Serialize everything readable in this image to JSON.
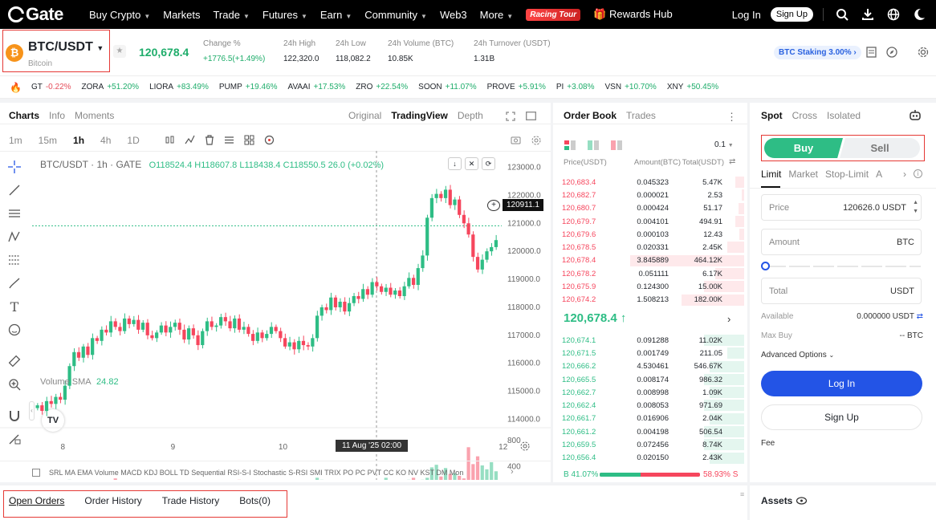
{
  "nav": {
    "logo": "Gate",
    "items": [
      "Buy Crypto",
      "Markets",
      "Trade",
      "Futures",
      "Earn",
      "Community",
      "Web3",
      "More"
    ],
    "dropdowns": [
      true,
      false,
      true,
      true,
      true,
      true,
      false,
      true
    ],
    "racing": "Racing Tour",
    "rewards": "Rewards Hub",
    "login": "Log In",
    "signup": "Sign Up"
  },
  "header": {
    "pair": "BTC/USDT",
    "coin_letter": "₿",
    "coin_name": "Bitcoin",
    "price": "120,678.4",
    "stats": [
      {
        "label": "Change %",
        "value": "+1776.5(+1.49%)"
      },
      {
        "label": "24h High",
        "value": "122,320.0"
      },
      {
        "label": "24h Low",
        "value": "118,082.2"
      },
      {
        "label": "24h Volume (BTC)",
        "value": "10.85K"
      },
      {
        "label": "24h Turnover (USDT)",
        "value": "1.31B"
      }
    ],
    "staking": "BTC Staking 3.00%"
  },
  "ticker": [
    {
      "sym": "GT",
      "chg": "-0.22%"
    },
    {
      "sym": "ZORA",
      "chg": "+51.20%"
    },
    {
      "sym": "LIORA",
      "chg": "+83.49%"
    },
    {
      "sym": "PUMP",
      "chg": "+19.46%"
    },
    {
      "sym": "AVAAI",
      "chg": "+17.53%"
    },
    {
      "sym": "ZRO",
      "chg": "+22.54%"
    },
    {
      "sym": "SOON",
      "chg": "+11.07%"
    },
    {
      "sym": "PROVE",
      "chg": "+5.91%"
    },
    {
      "sym": "PI",
      "chg": "+3.08%"
    },
    {
      "sym": "VSN",
      "chg": "+10.70%"
    },
    {
      "sym": "XNY",
      "chg": "+50.45%"
    }
  ],
  "chart": {
    "tabs": [
      "Charts",
      "Info",
      "Moments"
    ],
    "views": [
      "Original",
      "TradingView",
      "Depth"
    ],
    "intervals": [
      "1m",
      "15m",
      "1h",
      "4h",
      "1D"
    ],
    "legend_pair": "BTC/USDT · 1h · GATE",
    "ohlc": "O118524.4 H118607.8 L118438.4 C118550.5 26.0 (+0.02%)",
    "price_tag": "120911.1",
    "volume_label": "Volume SMA",
    "volume_value": "24.82",
    "crosshair_time": "11 Aug '25   02:00",
    "indicators": "SRL  MA  EMA  Volume  MACD  KDJ  BOLL  TD Sequential  RSI-S-I  Stochastic  S-RSI  SMI  TRIX  PO  PC  PVT  CC  KO  NV  KST  DM  Mon"
  },
  "chart_data": {
    "type": "candlestick",
    "y_ticks": [
      "123000.0",
      "122000.0",
      "121000.0",
      "120000.0",
      "119000.0",
      "118000.0",
      "117000.0",
      "116000.0",
      "115000.0",
      "114000.0"
    ],
    "ylim": [
      113700,
      123300
    ],
    "vol_ticks": [
      "800",
      "400"
    ],
    "vol_max": 1000,
    "x_ticks": [
      {
        "label": "8",
        "index": 6
      },
      {
        "label": "9",
        "index": 30
      },
      {
        "label": "10",
        "index": 54
      },
      {
        "label": "11",
        "index": 78
      },
      {
        "label": "12",
        "index": 102
      }
    ],
    "close": [
      114500,
      114300,
      114650,
      114550,
      114800,
      114700,
      115200,
      115900,
      116400,
      116200,
      116600,
      116300,
      116900,
      116800,
      117200,
      117100,
      117500,
      117300,
      117150,
      117600,
      117400,
      117550,
      117200,
      117450,
      117000,
      116900,
      117100,
      117350,
      117100,
      117300,
      117450,
      117200,
      116850,
      117250,
      117000,
      116650,
      117150,
      117500,
      117300,
      117350,
      117650,
      117500,
      117250,
      117600,
      117200,
      117300,
      117050,
      116800,
      117100,
      116900,
      117050,
      117300,
      117150,
      116900,
      116600,
      116750,
      116500,
      116800,
      116650,
      116600,
      116900,
      117700,
      118000,
      117900,
      118350,
      118000,
      118200,
      117850,
      118150,
      118400,
      118300,
      118650,
      118450,
      118900,
      118750,
      118550,
      118700,
      118450,
      118600,
      118400,
      118750,
      119050,
      118800,
      119400,
      119850,
      121200,
      121900,
      122050,
      121900,
      122200,
      121650,
      121850,
      121300,
      121000,
      120600,
      119800,
      119350,
      119700,
      120000,
      120150,
      120400
    ],
    "volume": [
      120,
      80,
      60,
      90,
      70,
      50,
      120,
      200,
      150,
      110,
      130,
      90,
      160,
      140,
      120,
      100,
      180,
      220,
      150,
      190,
      130,
      110,
      170,
      150,
      140,
      100,
      120,
      170,
      90,
      140,
      110,
      160,
      130,
      180,
      100,
      120,
      140,
      90,
      160,
      110,
      130,
      150,
      170,
      120,
      200,
      140,
      110,
      160,
      130,
      120,
      150,
      100,
      190,
      140,
      130,
      110,
      170,
      120,
      160,
      150,
      140,
      230,
      200,
      150,
      130,
      170,
      120,
      190,
      140,
      150,
      130,
      160,
      180,
      150,
      120,
      140,
      230,
      130,
      110,
      160,
      170,
      200,
      230,
      180,
      200,
      230,
      390,
      430,
      250,
      380,
      290,
      300,
      260,
      220,
      700,
      440,
      560,
      420,
      360,
      470,
      330
    ]
  },
  "orderbook": {
    "tabs": [
      "Order Book",
      "Trades"
    ],
    "precision": "0.1",
    "headers": [
      "Price(USDT)",
      "Amount(BTC)",
      "Total(USDT)"
    ],
    "asks": [
      [
        "120,683.4",
        "0.045323",
        "5.47K",
        0.08
      ],
      [
        "120,682.7",
        "0.000021",
        "2.53",
        0.02
      ],
      [
        "120,680.7",
        "0.000424",
        "51.17",
        0.05
      ],
      [
        "120,679.7",
        "0.004101",
        "494.91",
        0.08
      ],
      [
        "120,679.6",
        "0.000103",
        "12.43",
        0.04
      ],
      [
        "120,678.5",
        "0.020331",
        "2.45K",
        0.15
      ],
      [
        "120,678.4",
        "3.845889",
        "464.12K",
        1.0
      ],
      [
        "120,678.2",
        "0.051111",
        "6.17K",
        0.25
      ],
      [
        "120,675.9",
        "0.124300",
        "15.00K",
        0.35
      ],
      [
        "120,674.2",
        "1.508213",
        "182.00K",
        0.55
      ]
    ],
    "mid_price": "120,678.4",
    "bids": [
      [
        "120,674.1",
        "0.091288",
        "11.02K",
        0.35
      ],
      [
        "120,671.5",
        "0.001749",
        "211.05",
        0.15
      ],
      [
        "120,666.2",
        "4.530461",
        "546.67K",
        0.3
      ],
      [
        "120,665.5",
        "0.008174",
        "986.32",
        0.35
      ],
      [
        "120,662.7",
        "0.008998",
        "1.09K",
        0.3
      ],
      [
        "120,662.4",
        "0.008053",
        "971.69",
        0.35
      ],
      [
        "120,661.7",
        "0.016906",
        "2.04K",
        0.3
      ],
      [
        "120,661.2",
        "0.004198",
        "506.54",
        0.35
      ],
      [
        "120,659.5",
        "0.072456",
        "8.74K",
        0.35
      ],
      [
        "120,656.4",
        "0.020150",
        "2.43K",
        0.3
      ]
    ],
    "buy_ratio": "B 41.07%",
    "sell_ratio": "58.93% S",
    "buy_fraction": 0.4107
  },
  "spot": {
    "tabs": [
      "Spot",
      "Cross",
      "Isolated"
    ],
    "buy": "Buy",
    "sell": "Sell",
    "order_types": [
      "Limit",
      "Market",
      "Stop-Limit",
      "A"
    ],
    "price_label": "Price",
    "price_value": "120626.0 USDT",
    "amount_label": "Amount",
    "amount_unit": "BTC",
    "total_label": "Total",
    "total_unit": "USDT",
    "available_label": "Available",
    "available_value": "0.000000 USDT",
    "maxbuy_label": "Max Buy",
    "maxbuy_value": "-- BTC",
    "advanced": "Advanced Options",
    "login": "Log In",
    "signup": "Sign Up",
    "fee": "Fee"
  },
  "bottom": {
    "tabs": [
      "Open Orders",
      "Order History",
      "Trade History",
      "Bots(0)"
    ],
    "assets": "Assets"
  },
  "colors": {
    "up": "#2ebd85",
    "down": "#f6465d",
    "brand_blue": "#2354e6"
  }
}
